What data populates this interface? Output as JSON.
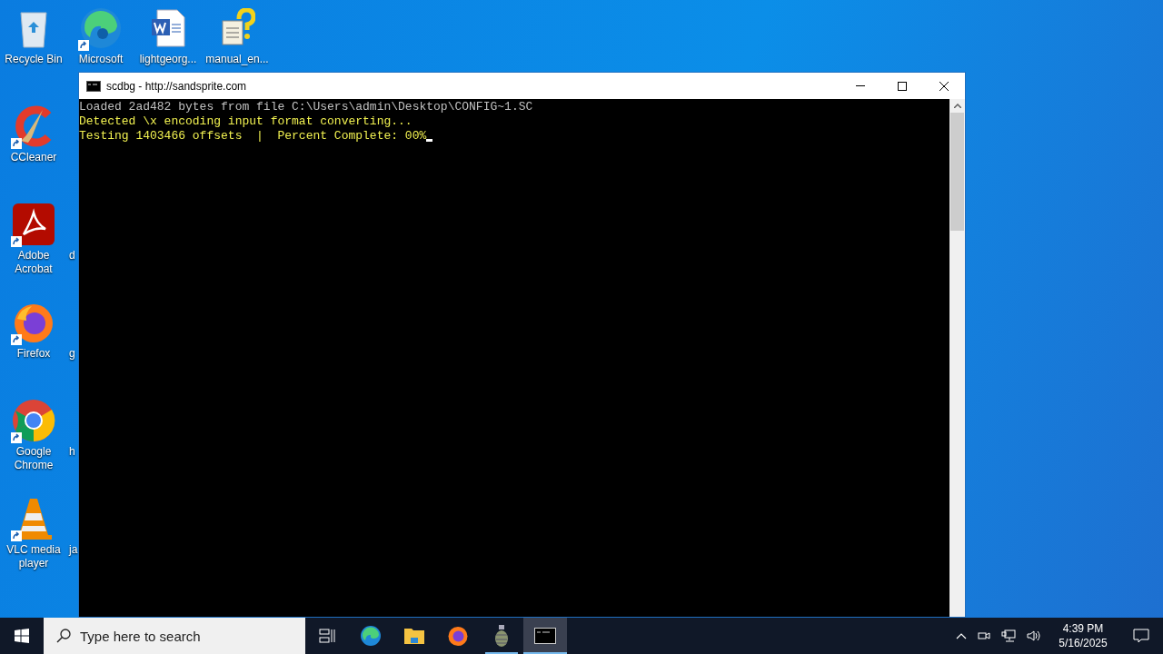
{
  "desktop_icons": [
    {
      "label": "Recycle Bin",
      "kind": "recycle",
      "shortcut": false
    },
    {
      "label": "Microsoft",
      "kind": "edge",
      "shortcut": true
    },
    {
      "label": "lightgeorg...",
      "kind": "word",
      "shortcut": false
    },
    {
      "label": "manual_en...",
      "kind": "help",
      "shortcut": false
    },
    {
      "label": "CCleaner",
      "kind": "ccleaner",
      "shortcut": true
    },
    {
      "label": "Adobe Acrobat",
      "kind": "acrobat",
      "shortcut": true
    },
    {
      "label": "Firefox",
      "kind": "firefox",
      "shortcut": true
    },
    {
      "label": "Google Chrome",
      "kind": "chrome",
      "shortcut": true
    },
    {
      "label": "VLC media player",
      "kind": "vlc",
      "shortcut": true
    }
  ],
  "covered_icon_labels": [
    "d",
    "g",
    "h",
    "ja"
  ],
  "console_window": {
    "title": "scdbg - http://sandsprite.com",
    "lines": [
      {
        "text": "Loaded 2ad482 bytes from file C:\\Users\\admin\\Desktop\\CONFIG~1.SC",
        "kind": "plain"
      },
      {
        "text": "Detected \\x encoding input format converting...",
        "kind": "highlight"
      },
      {
        "text": "Testing 1403466 offsets  |  Percent Complete: 00%",
        "kind": "highlight"
      }
    ]
  },
  "taskbar": {
    "search": {
      "placeholder": "Type here to search"
    },
    "apps": [
      {
        "kind": "taskview",
        "running": false,
        "selected": false
      },
      {
        "kind": "edge",
        "running": false,
        "selected": false
      },
      {
        "kind": "folder",
        "running": false,
        "selected": false
      },
      {
        "kind": "firefox",
        "running": false,
        "selected": false
      },
      {
        "kind": "grenade",
        "running": true,
        "selected": false
      },
      {
        "kind": "console",
        "running": true,
        "selected": true
      }
    ],
    "time": "4:39 PM",
    "date": "5/16/2025"
  }
}
